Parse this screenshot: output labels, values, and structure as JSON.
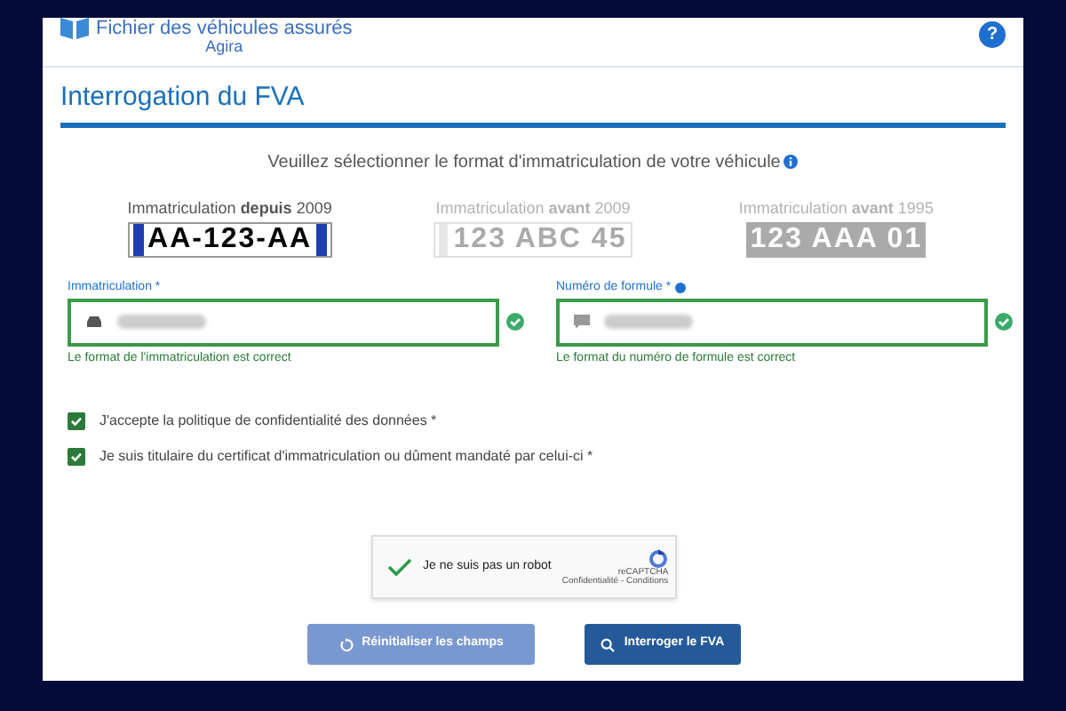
{
  "header": {
    "title": "Fichier des véhicules assurés",
    "subtitle": "Agira",
    "help": "?"
  },
  "section_title": "Interrogation du FVA",
  "prompt": "Veuillez sélectionner le format d'immatriculation de votre véhicule",
  "plate_formats": [
    {
      "label": "Immatriculation **depuis** 2009",
      "plate": "AA-123-AA",
      "kind": "eu",
      "selected": true
    },
    {
      "label": "Immatriculation **avant** 2009",
      "plate": "123 ABC 45",
      "kind": "old",
      "selected": false
    },
    {
      "label": "Immatriculation **avant** 1995",
      "plate": "123 AAA 01",
      "kind": "older",
      "selected": false
    }
  ],
  "fields": [
    {
      "label": "Immatriculation *",
      "kind": "car",
      "valid": true,
      "info": false,
      "help": "Le format de l'immatriculation est correct"
    },
    {
      "label": "Numéro de formule *",
      "kind": "card",
      "valid": true,
      "info": true,
      "help": "Le format du numéro de formule est correct"
    }
  ],
  "consents": [
    {
      "label": "J'accepte la politique de confidentialité des données *",
      "checked": true
    },
    {
      "label": "Je suis titulaire du certificat d'immatriculation ou dûment mandaté par celui-ci *",
      "checked": true
    }
  ],
  "captcha": {
    "label": "Je ne suis pas un robot",
    "checked": true,
    "brand": "reCAPTCHA",
    "links": "Confidentialité - Conditions"
  },
  "buttons": [
    {
      "label": "Réinitialiser les champs",
      "kind": "reset"
    },
    {
      "label": "Interroger le FVA",
      "kind": "search"
    }
  ]
}
